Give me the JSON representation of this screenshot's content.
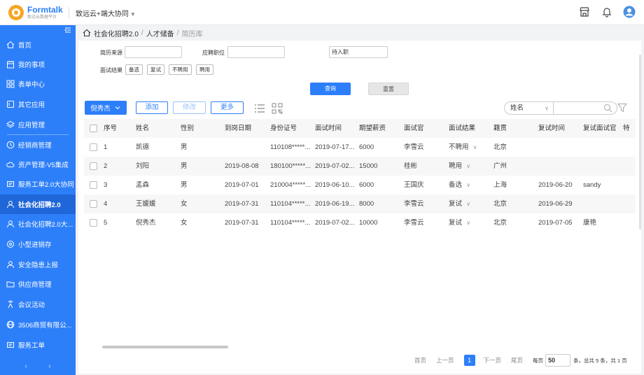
{
  "topbar": {
    "logo_name": "Formtalk",
    "logo_sub": "致远云数据平台",
    "org": "致远云+端大协同"
  },
  "sidebar": {
    "items": [
      {
        "label": "首页",
        "icon": "home-icon"
      },
      {
        "label": "我的事项",
        "icon": "calendar-icon"
      },
      {
        "label": "表单中心",
        "icon": "grid-icon"
      },
      {
        "label": "其它应用",
        "icon": "app-icon"
      },
      {
        "label": "应用管理",
        "icon": "layers-icon"
      },
      {
        "label": "经销商管理",
        "icon": "clock-icon"
      },
      {
        "label": "资产管理-V5集成",
        "icon": "cloud-icon"
      },
      {
        "label": "服务工单2.0大协同",
        "icon": "ticket-icon"
      },
      {
        "label": "社会化招聘2.0",
        "icon": "user-icon"
      },
      {
        "label": "社会化招聘2.0大...",
        "icon": "user-icon"
      },
      {
        "label": "小型进销存",
        "icon": "gear-icon"
      },
      {
        "label": "安全隐患上报",
        "icon": "user-icon"
      },
      {
        "label": "供应商管理",
        "icon": "folder-icon"
      },
      {
        "label": "会议活动",
        "icon": "antenna-icon"
      },
      {
        "label": "3506商贸有限公...",
        "icon": "globe-icon"
      },
      {
        "label": "服务工单",
        "icon": "ticket-icon"
      }
    ],
    "active_index": 8
  },
  "breadcrumb": {
    "app": "社会化招聘2.0",
    "sep": "/",
    "section": "人才储备",
    "current": "简历库"
  },
  "filters": {
    "source_label": "简历来源",
    "source_value": "",
    "position_label": "应聘职位",
    "position_value": "",
    "status_value": "待入职",
    "result_label": "面试结果",
    "result_tags": [
      "备选",
      "复试",
      "不聘用",
      "聘用"
    ],
    "query_label": "查询",
    "reset_label": "重置"
  },
  "toolbar": {
    "user_dropdown": "倪秀杰",
    "add": "添加",
    "edit": "修改",
    "more": "更多",
    "search_field": "姓名",
    "search_value": ""
  },
  "table": {
    "columns": [
      "序号",
      "姓名",
      "性别",
      "到岗日期",
      "身份证号",
      "面试时间",
      "期望薪资",
      "面试官",
      "面试结果",
      "籍贯",
      "复试时间",
      "复试面试官",
      "特"
    ],
    "rows": [
      [
        "1",
        "凯德",
        "男",
        "",
        "110108*****...",
        "2019-07-17...",
        "6000",
        "李雪云",
        "不聘用",
        "北京",
        "",
        ""
      ],
      [
        "2",
        "刘阳",
        "男",
        "2019-08-08",
        "180100*****...",
        "2019-07-02...",
        "15000",
        "桂彬",
        "聘用",
        "广州",
        "",
        ""
      ],
      [
        "3",
        "孟森",
        "男",
        "2019-07-01",
        "210004*****...",
        "2019-06-10...",
        "6000",
        "王国庆",
        "备选",
        "上海",
        "2019-06-20",
        "sandy"
      ],
      [
        "4",
        "王媛媛",
        "女",
        "2019-07-31",
        "110104*****...",
        "2019-06-19...",
        "8000",
        "李雪云",
        "复试",
        "北京",
        "2019-06-29",
        ""
      ],
      [
        "5",
        "倪秀杰",
        "女",
        "2019-07-31",
        "110104*****...",
        "2019-07-02...",
        "10000",
        "李雪云",
        "复试",
        "北京",
        "2019-07-05",
        "康艳"
      ]
    ]
  },
  "pagination": {
    "first": "首页",
    "prev": "上一页",
    "current": "1",
    "next": "下一页",
    "last": "尾页",
    "size_label": "每页",
    "size": "50",
    "total": "条，总共 5 条，共 1 页"
  },
  "colors": {
    "primary": "#2d7ff9",
    "sidebar_active": "#1f66d9"
  }
}
